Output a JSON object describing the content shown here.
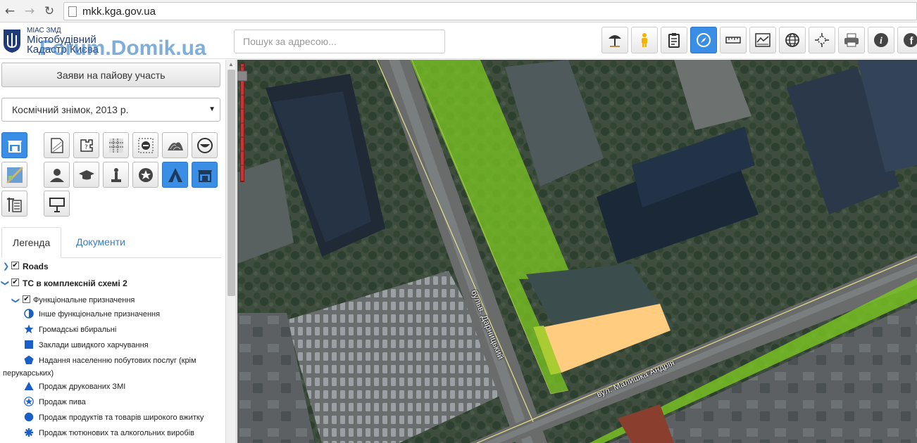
{
  "browser": {
    "url": "mkk.kga.gov.ua",
    "back_icon": "back-arrow-icon",
    "forward_icon": "forward-arrow-icon",
    "reload_icon": "reload-icon"
  },
  "header": {
    "logo": {
      "line1": "МІАС ЗМД",
      "line2": "Містобудівний",
      "line3": "Кадастр Києва",
      "watermark": "Forum.Domik.ua"
    },
    "search": {
      "placeholder": "Пошук за адресою..."
    },
    "tools": [
      {
        "icon": "beach-umbrella-icon",
        "active": false
      },
      {
        "icon": "pegman-icon",
        "active": false
      },
      {
        "icon": "clipboard-icon",
        "active": false
      },
      {
        "icon": "compass-icon",
        "active": true
      },
      {
        "icon": "ruler-icon",
        "active": false
      },
      {
        "icon": "profile-icon",
        "active": false
      },
      {
        "icon": "globe-icon",
        "active": false
      },
      {
        "icon": "crosshair-icon",
        "active": false
      },
      {
        "icon": "printer-icon",
        "active": false
      },
      {
        "icon": "info-icon",
        "active": false
      },
      {
        "icon": "facebook-icon",
        "active": false
      }
    ]
  },
  "sidebar": {
    "pai_button": "Заяви на пайову участь",
    "layer_select": "Космічний знімок, 2013 р.",
    "layer_buttons": [
      {
        "icon": "shop-icon",
        "active": true
      },
      {
        "icon": "document-map-icon",
        "active": false
      },
      {
        "icon": "puzzle-plan-icon",
        "active": false
      },
      {
        "icon": "hatched-grid-icon",
        "active": false
      },
      {
        "icon": "restricted-zone-icon",
        "active": false
      },
      {
        "icon": "hill-icon",
        "active": false
      },
      {
        "icon": "road-sign-icon",
        "active": false
      },
      {
        "icon": "satellite-tile-icon",
        "active": false
      },
      {
        "icon": "person-icon",
        "active": false
      },
      {
        "icon": "graduation-cap-icon",
        "active": false
      },
      {
        "icon": "monument-icon",
        "active": false
      },
      {
        "icon": "police-badge-icon",
        "active": false
      },
      {
        "icon": "tent-icon",
        "active": true
      },
      {
        "icon": "store-icon",
        "active": true
      },
      {
        "icon": "building-crane-icon",
        "active": false
      },
      {
        "icon": "billboard-icon",
        "active": false
      }
    ],
    "tabs": [
      "Легенда",
      "Документи"
    ],
    "legend": {
      "groups": [
        {
          "label": "Roads",
          "checked": true,
          "expanded": false
        },
        {
          "label": "ТС в комплексній схемі 2",
          "checked": true,
          "expanded": true
        }
      ],
      "subgroup": {
        "label": "Функціональне призначення",
        "checked": true
      },
      "items": [
        {
          "label": "Інше функціональне призначення",
          "symbol": "half-circle-icon"
        },
        {
          "label": "Громадські вбиральні",
          "symbol": "star-icon"
        },
        {
          "label": "Заклади швидкого харчування",
          "symbol": "square-icon"
        },
        {
          "label": "Надання населенню побутових послуг (крім",
          "label2": "перукарських)",
          "symbol": "pentagon-icon"
        },
        {
          "label": "Продаж друкованих ЗМІ",
          "symbol": "triangle-icon"
        },
        {
          "label": "Продаж пива",
          "symbol": "circled-star-icon"
        },
        {
          "label": "Продаж продуктів та товарів широкого вжитку",
          "symbol": "circle-icon"
        },
        {
          "label": "Продаж тютюнових та алкогольних виробів",
          "symbol": "asterisk-icon"
        }
      ],
      "symbol_color": "#1a5fc7"
    }
  },
  "map": {
    "streets": [
      {
        "label": "бульв. Дарницький"
      },
      {
        "label": "вул. Малишка Андрія"
      }
    ],
    "colors": {
      "green_zone": "#7cc823",
      "parcel": "#ffcc80",
      "boundary": "#e8e08a"
    }
  }
}
